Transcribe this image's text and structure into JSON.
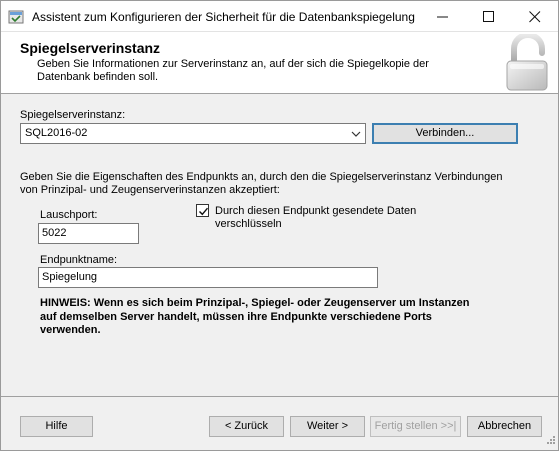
{
  "window": {
    "title": "Assistent zum Konfigurieren der Sicherheit für die Datenbankspiegelung"
  },
  "header": {
    "title": "Spiegelserverinstanz",
    "description": "Geben Sie Informationen zur Serverinstanz an, auf der sich die Spiegelkopie der Datenbank befinden soll."
  },
  "form": {
    "mirror_instance_label": "Spiegelserverinstanz:",
    "mirror_instance_value": "SQL2016-02",
    "connect_label": "Verbinden...",
    "endpoint_intro": "Geben Sie die Eigenschaften des Endpunkts an, durch den die Spiegelserverinstanz Verbindungen von Prinzipal- und Zeugenserverinstanzen akzeptiert:",
    "port_label": "Lauschport:",
    "port_value": "5022",
    "encrypt_label": "Durch diesen Endpunkt gesendete Daten verschlüsseln",
    "encrypt_checked": true,
    "endpoint_name_label": "Endpunktname:",
    "endpoint_name_value": "Spiegelung",
    "note": "HINWEIS: Wenn es sich beim Prinzipal-, Spiegel- oder Zeugenserver um Instanzen auf demselben Server handelt, müssen ihre Endpunkte verschiedene Ports verwenden."
  },
  "footer": {
    "help": "Hilfe",
    "back": "< Zurück",
    "next": "Weiter >",
    "finish": "Fertig stellen >>|",
    "cancel": "Abbrechen"
  },
  "icons": {
    "app": "wizard-app-icon",
    "lock": "padlock-open-icon",
    "dropdown": "chevron-down-icon",
    "check": "checkmark-icon"
  },
  "colors": {
    "accent_border": "#3c7fb1",
    "window_bg": "#f0f0f0",
    "header_bg": "#ffffff"
  }
}
